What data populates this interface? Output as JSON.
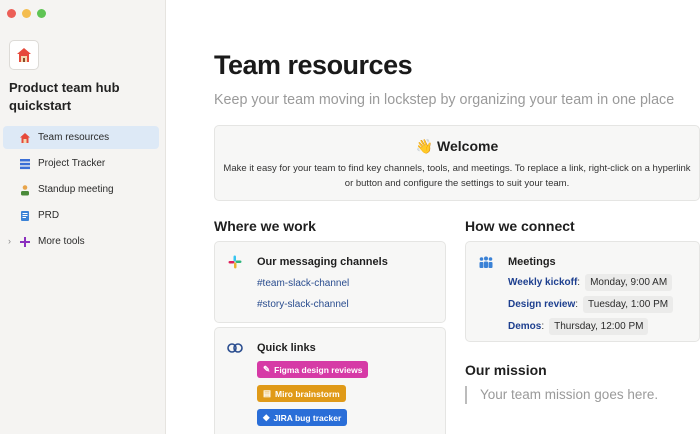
{
  "workspace": {
    "title": "Product team hub quickstart",
    "icon": "house-icon"
  },
  "sidebar": {
    "items": [
      {
        "label": "Team resources",
        "icon": "house-icon"
      },
      {
        "label": "Project Tracker",
        "icon": "list-icon"
      },
      {
        "label": "Standup meeting",
        "icon": "people-icon"
      },
      {
        "label": "PRD",
        "icon": "document-icon"
      },
      {
        "label": "More tools",
        "icon": "plus-icon"
      }
    ]
  },
  "page": {
    "title": "Team resources",
    "subtitle": "Keep your team moving in lockstep by organizing your team in one place",
    "welcome": {
      "emoji": "👋",
      "heading": "Welcome",
      "body": "Make it easy for your team to find key channels, tools, and meetings. To replace a link, right-click on a hyperlink or button and configure the settings to suit your team."
    }
  },
  "where_we_work": {
    "heading": "Where we work",
    "messaging": {
      "title": "Our messaging channels",
      "channels": [
        "#team-slack-channel",
        "#story-slack-channel"
      ]
    },
    "quick_links": {
      "title": "Quick links",
      "links": [
        {
          "label": "Figma design reviews",
          "color": "#d63aa6"
        },
        {
          "label": "Miro brainstorm",
          "color": "#e09a18"
        },
        {
          "label": "JIRA bug tracker",
          "color": "#2a6ed8"
        }
      ]
    }
  },
  "how_we_connect": {
    "heading": "How we connect",
    "meetings": {
      "title": "Meetings",
      "items": [
        {
          "name": "Weekly kickoff",
          "time": "Monday, 9:00 AM"
        },
        {
          "name": "Design review",
          "time": "Tuesday, 1:00 PM"
        },
        {
          "name": "Demos",
          "time": "Thursday, 12:00 PM"
        }
      ]
    }
  },
  "mission": {
    "heading": "Our mission",
    "placeholder": "Your team mission goes here."
  },
  "colors": {
    "accent": "#2a4d8f",
    "active_nav": "#dde9f6",
    "sidebar_bg": "#f5f4f2"
  }
}
